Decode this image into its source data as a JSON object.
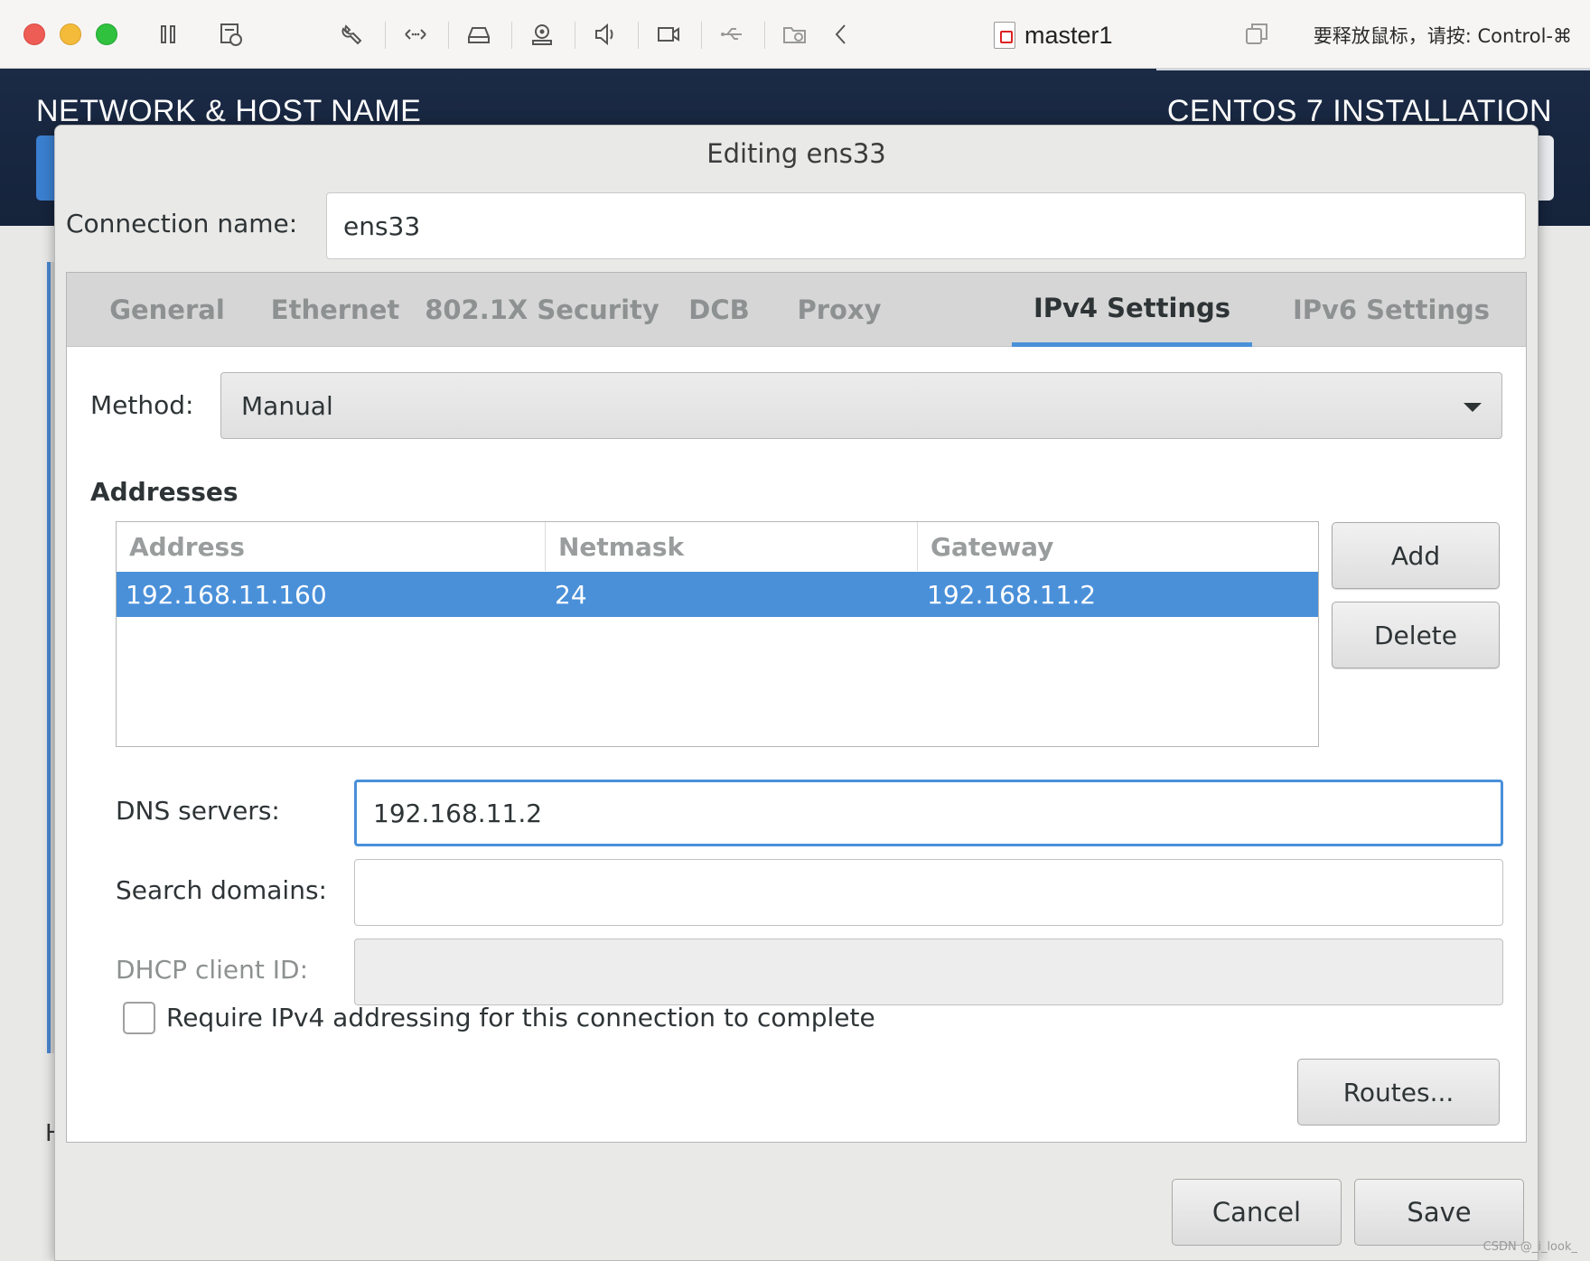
{
  "toolbar": {
    "vm_title": "master1",
    "release_hint": "要释放鼠标，请按: Control-⌘",
    "icons": [
      "pause-icon",
      "snapshot-icon",
      "wrench-icon",
      "network-arrows-icon",
      "hard-disk-icon",
      "camera-icon",
      "speaker-icon",
      "video-camera-icon",
      "usb-icon",
      "shared-folder-icon",
      "chevron-left-icon",
      "restore-window-icon"
    ]
  },
  "background": {
    "spoke_title": "NETWORK & HOST NAME",
    "product_title": "CENTOS 7 INSTALLATION",
    "partial_letter": "H"
  },
  "dialog": {
    "title": "Editing ens33",
    "connection_name_label": "Connection name:",
    "connection_name_value": "ens33",
    "tabs": [
      {
        "label": "General",
        "active": false
      },
      {
        "label": "Ethernet",
        "active": false
      },
      {
        "label": "802.1X Security",
        "active": false
      },
      {
        "label": "DCB",
        "active": false
      },
      {
        "label": "Proxy",
        "active": false
      },
      {
        "label": "IPv4 Settings",
        "active": true
      },
      {
        "label": "IPv6 Settings",
        "active": false
      }
    ],
    "ipv4": {
      "method_label": "Method:",
      "method_value": "Manual",
      "addresses_heading": "Addresses",
      "columns": [
        "Address",
        "Netmask",
        "Gateway"
      ],
      "rows": [
        {
          "address": "192.168.11.160",
          "netmask": "24",
          "gateway": "192.168.11.2"
        }
      ],
      "add_label": "Add",
      "delete_label": "Delete",
      "dns_label": "DNS servers:",
      "dns_value": "192.168.11.2",
      "search_label": "Search domains:",
      "search_value": "",
      "dhcp_label": "DHCP client ID:",
      "dhcp_value": "",
      "require_label": "Require IPv4 addressing for this connection to complete",
      "require_checked": false,
      "routes_label": "Routes..."
    },
    "cancel_label": "Cancel",
    "save_label": "Save"
  },
  "watermark": "CSDN @_i_look_",
  "colors": {
    "accent": "#4a90d9",
    "header_bg": "#1b2a45",
    "selection": "#4a90d9"
  }
}
